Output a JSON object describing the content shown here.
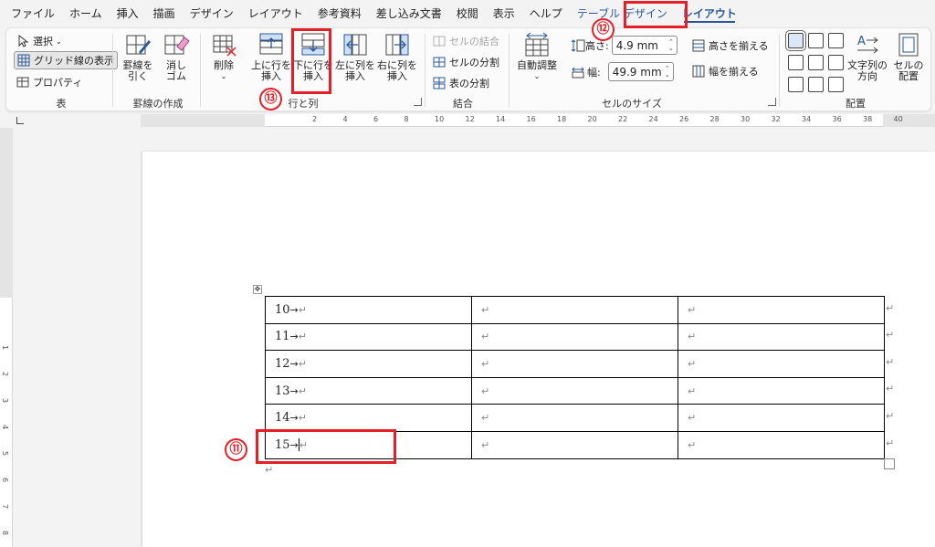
{
  "menu": {
    "tabs": [
      "ファイル",
      "ホーム",
      "挿入",
      "描画",
      "デザイン",
      "レイアウト",
      "参考資料",
      "差し込み文書",
      "校閲",
      "表示",
      "ヘルプ"
    ],
    "context_tab": "テーブル デザイン",
    "active_tab": "レイアウト"
  },
  "ribbon": {
    "table_group": {
      "select": "選択",
      "gridlines": "グリッド線の表示",
      "properties": "プロパティ",
      "label": "表"
    },
    "draw_group": {
      "draw_table_l1": "罫線を",
      "draw_table_l2": "引く",
      "eraser_l1": "消し",
      "eraser_l2": "ゴム",
      "label": "罫線の作成"
    },
    "rows_cols_group": {
      "delete": "削除",
      "insert_above_l1": "上に行を",
      "insert_above_l2": "挿入",
      "insert_below_l1": "下に行を",
      "insert_below_l2": "挿入",
      "insert_left_l1": "左に列を",
      "insert_left_l2": "挿入",
      "insert_right_l1": "右に列を",
      "insert_right_l2": "挿入",
      "label": "行と列"
    },
    "merge_group": {
      "merge_cells": "セルの結合",
      "split_cells": "セルの分割",
      "split_table": "表の分割",
      "label": "結合"
    },
    "cell_size_group": {
      "autofit": "自動調整",
      "height_label": "高さ:",
      "height_value": "4.9 mm",
      "width_label": "幅:",
      "width_value": "49.9 mm",
      "distribute_rows": "高さを揃える",
      "distribute_cols": "幅を揃える",
      "label": "セルのサイズ"
    },
    "alignment_group": {
      "text_direction_l1": "文字列の",
      "text_direction_l2": "方向",
      "cell_margins_l1": "セルの",
      "cell_margins_l2": "配置",
      "label": "配置"
    }
  },
  "annotations": {
    "step11": "⑪",
    "step12": "⑫",
    "step13": "⑬"
  },
  "ruler": {
    "h_numbers": [
      "2",
      "4",
      "6",
      "8",
      "10",
      "12",
      "14",
      "16",
      "18",
      "20",
      "22",
      "24",
      "26",
      "28",
      "30",
      "32",
      "34",
      "36",
      "38",
      "40"
    ],
    "v_numbers": [
      "1",
      "2",
      "3",
      "4",
      "5",
      "6",
      "7",
      "8",
      "9"
    ]
  },
  "document": {
    "rows": [
      {
        "c1": "10",
        "c2": "",
        "c3": ""
      },
      {
        "c1": "11",
        "c2": "",
        "c3": ""
      },
      {
        "c1": "12",
        "c2": "",
        "c3": ""
      },
      {
        "c1": "13",
        "c2": "",
        "c3": ""
      },
      {
        "c1": "14",
        "c2": "",
        "c3": ""
      },
      {
        "c1": "15",
        "c2": "",
        "c3": ""
      }
    ],
    "tab_mark": "→",
    "cell_mark": "↵",
    "para_mark": "↵"
  },
  "colors": {
    "accent": "#2b579a",
    "highlight": "#e41f27"
  }
}
